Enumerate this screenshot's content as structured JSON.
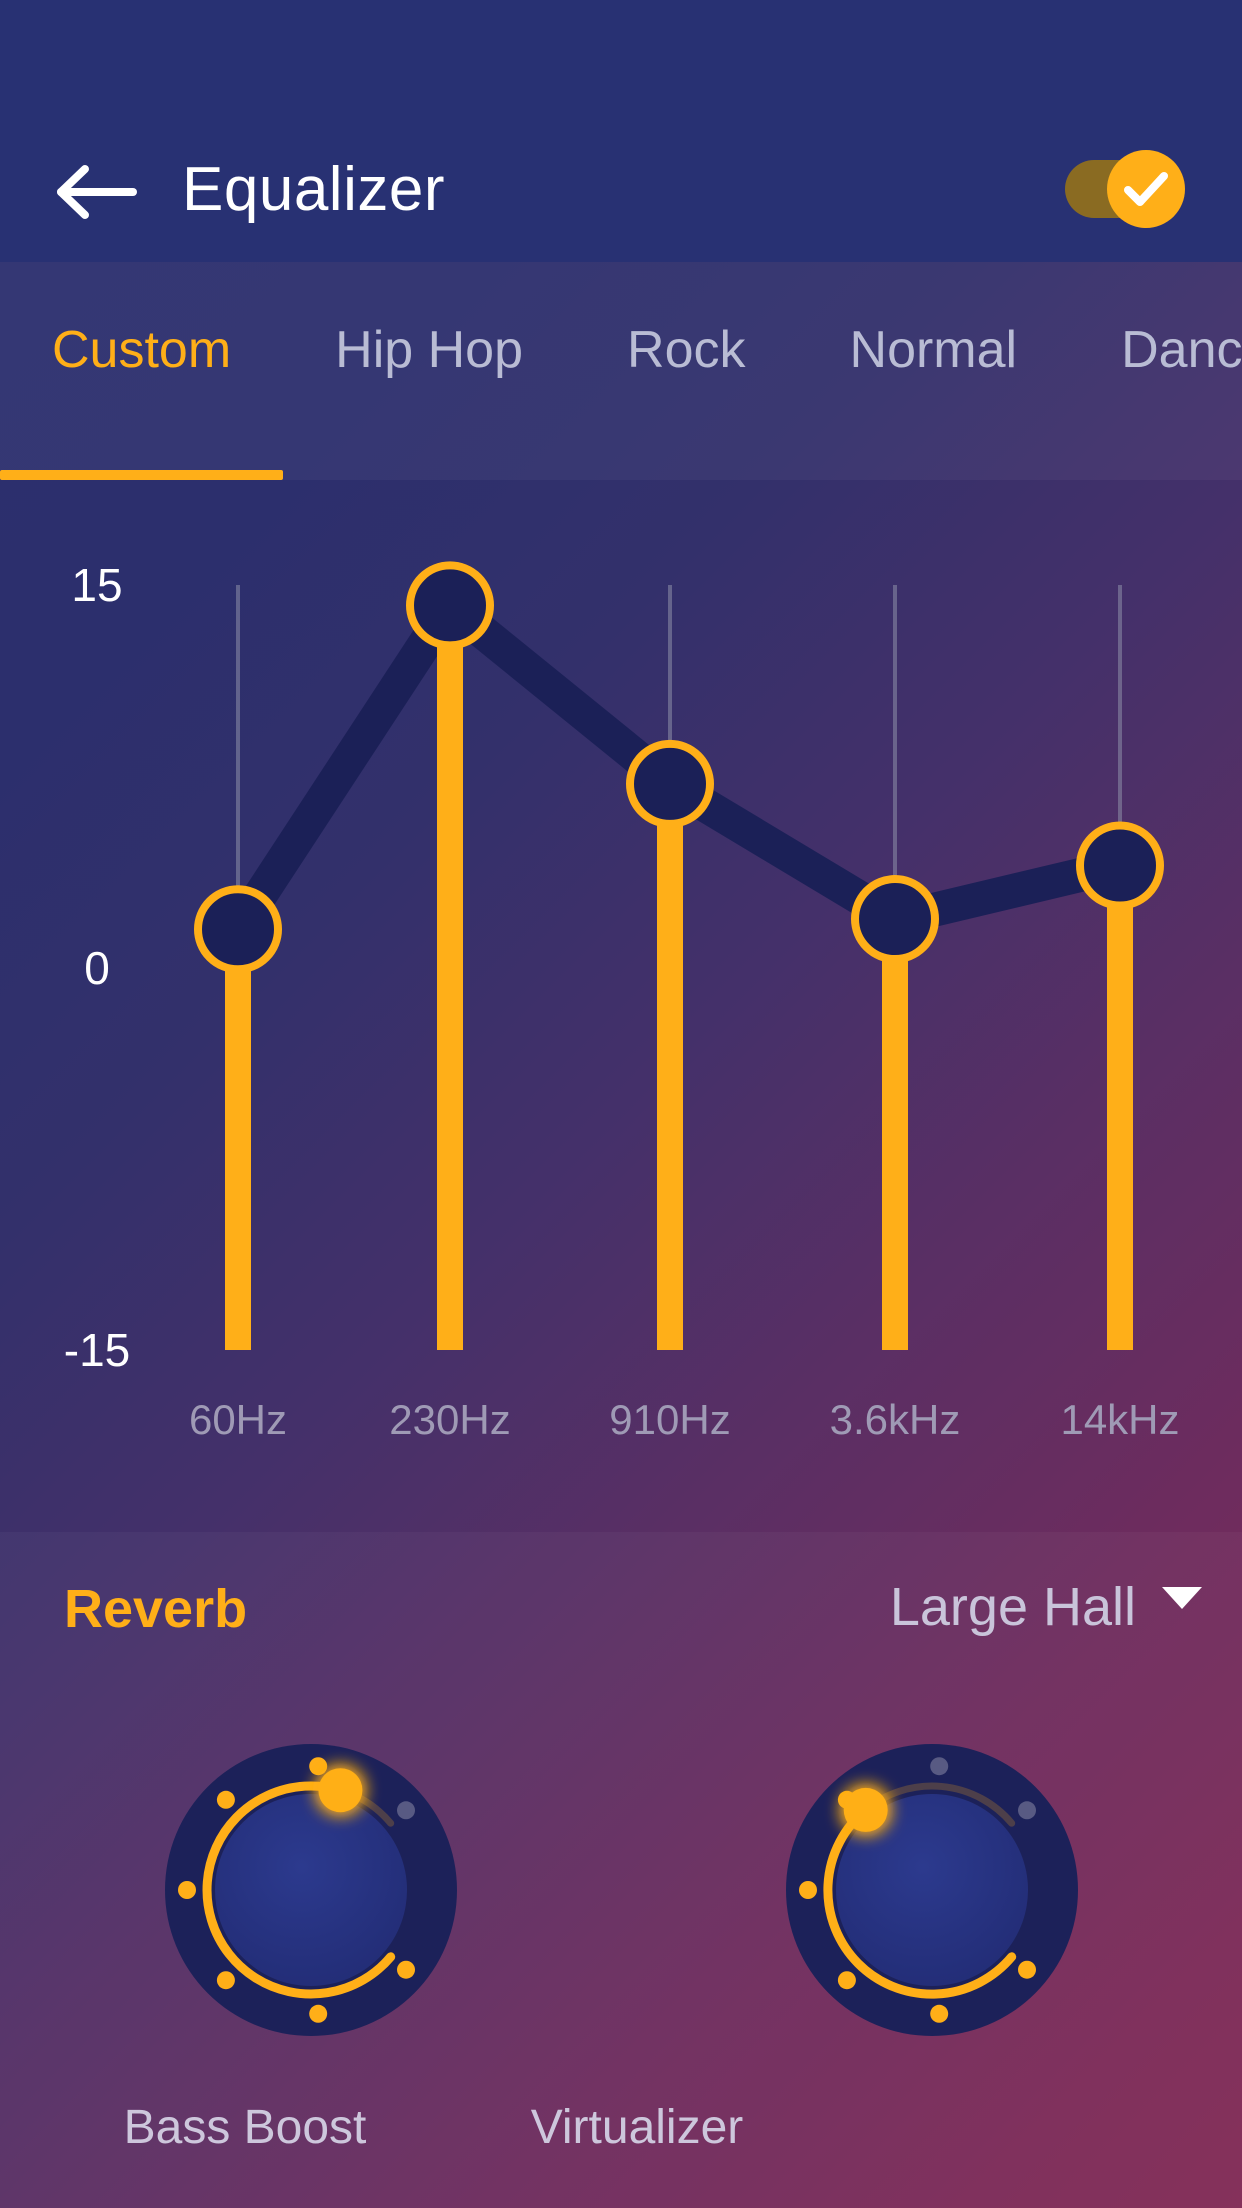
{
  "header": {
    "title": "Equalizer",
    "back_icon": "arrow-left-icon",
    "toggle": {
      "state": "on",
      "icon": "check-icon"
    }
  },
  "tabs": {
    "items": [
      {
        "label": "Custom",
        "active": true
      },
      {
        "label": "Hip Hop",
        "active": false
      },
      {
        "label": "Rock",
        "active": false
      },
      {
        "label": "Normal",
        "active": false
      },
      {
        "label": "Dance",
        "active": false
      }
    ]
  },
  "chart_data": {
    "type": "line",
    "title": "",
    "xlabel": "",
    "ylabel": "",
    "ylim": [
      -15,
      15
    ],
    "y_ticks": [
      "15",
      "0",
      "-15"
    ],
    "categories": [
      "60Hz",
      "230Hz",
      "910Hz",
      "3.6kHz",
      "14kHz"
    ],
    "values": [
      1.5,
      14.2,
      7.2,
      1.9,
      4.0
    ],
    "grid": false,
    "legend": "none",
    "series": [
      {
        "name": "Custom",
        "values": [
          1.5,
          14.2,
          7.2,
          1.9,
          4.0
        ]
      }
    ]
  },
  "effects": {
    "reverb_label": "Reverb",
    "reverb_value": "Large Hall",
    "reverb_caret_icon": "chevron-down-icon",
    "knobs": [
      {
        "name": "bass-boost",
        "label": "Bass Boost",
        "value": 88
      },
      {
        "name": "virtualizer",
        "label": "Virtualizer",
        "value": 68
      }
    ]
  },
  "colors": {
    "accent": "#ffaf18",
    "header_bg": "#283173",
    "thumb_fill": "#1b2057",
    "track_inactive": "#8d8fa8",
    "text_muted": "#9f9ab5"
  }
}
